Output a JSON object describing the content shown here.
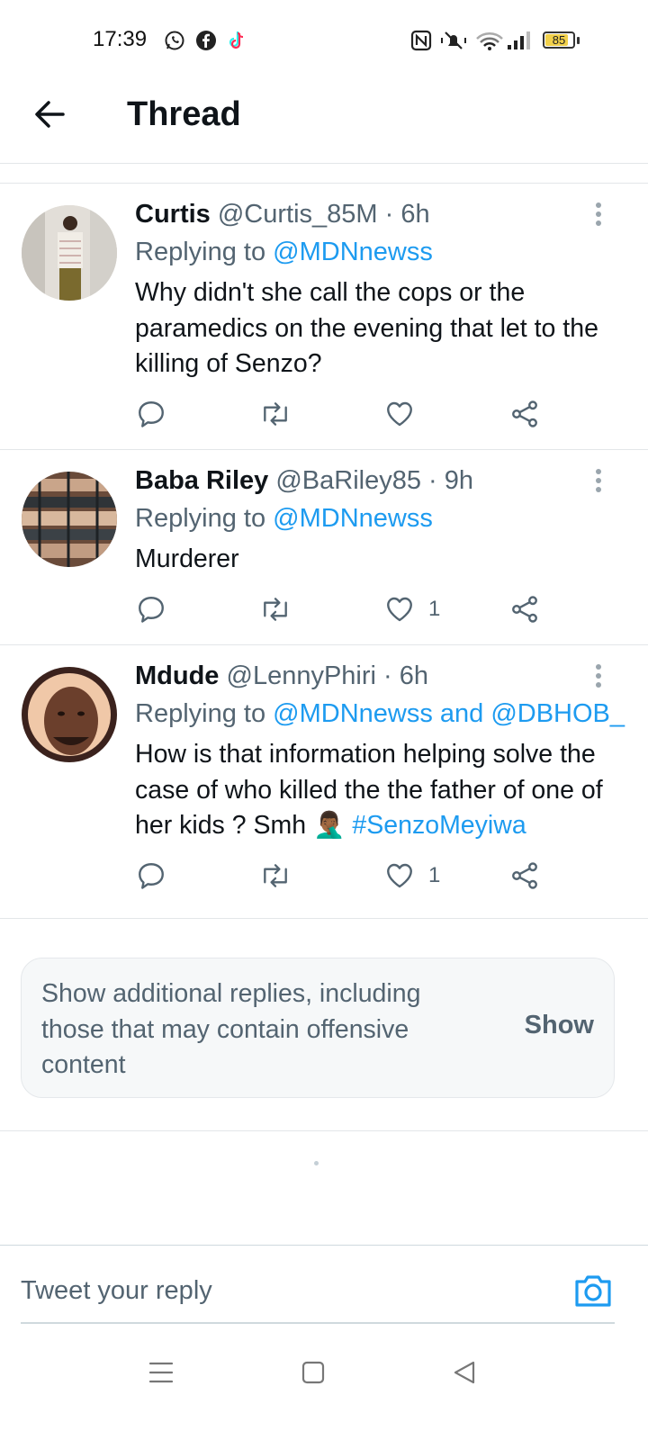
{
  "status_bar": {
    "time": "17:39",
    "battery": "85",
    "battery_level": 0.85,
    "left_icons": [
      "whatsapp-icon",
      "facebook-icon",
      "tiktok-icon"
    ],
    "right_icons": [
      "nfc-icon",
      "muted-bell-icon",
      "wifi-icon",
      "signal-icon",
      "battery-icon"
    ]
  },
  "header": {
    "title": "Thread"
  },
  "tweets": [
    {
      "name": "Curtis",
      "handle": "@Curtis_85M",
      "time": "· 6h",
      "replying_prefix": "Replying to ",
      "replying_to": "@MDNnewss",
      "text": "Why didn't she call the cops or the paramedics on the evening that let to the killing of Senzo?",
      "likes": ""
    },
    {
      "name": "Baba Riley",
      "handle": "@BaRiley85",
      "time": "· 9h",
      "replying_prefix": "Replying to ",
      "replying_to": "@MDNnewss",
      "text": "Murderer",
      "likes": "1"
    },
    {
      "name": "Mdude",
      "handle": "@LennyPhiri",
      "time": "· 6h",
      "replying_prefix": "Replying to ",
      "replying_to": "@MDNnewss and @DBHOB_",
      "text": "How is that information helping solve the case of who killed the  the father of one of her kids ? Smh 🤦🏾‍♂️ ",
      "hashtag": "#SenzoMeyiwa",
      "likes": "1"
    }
  ],
  "show_more": {
    "text": "Show additional replies, including those that may contain offensive content",
    "button": "Show"
  },
  "reply": {
    "placeholder": "Tweet your reply"
  },
  "colors": {
    "link": "#1d9bf0",
    "secondary": "#536471",
    "primary_text": "#0f1419"
  }
}
